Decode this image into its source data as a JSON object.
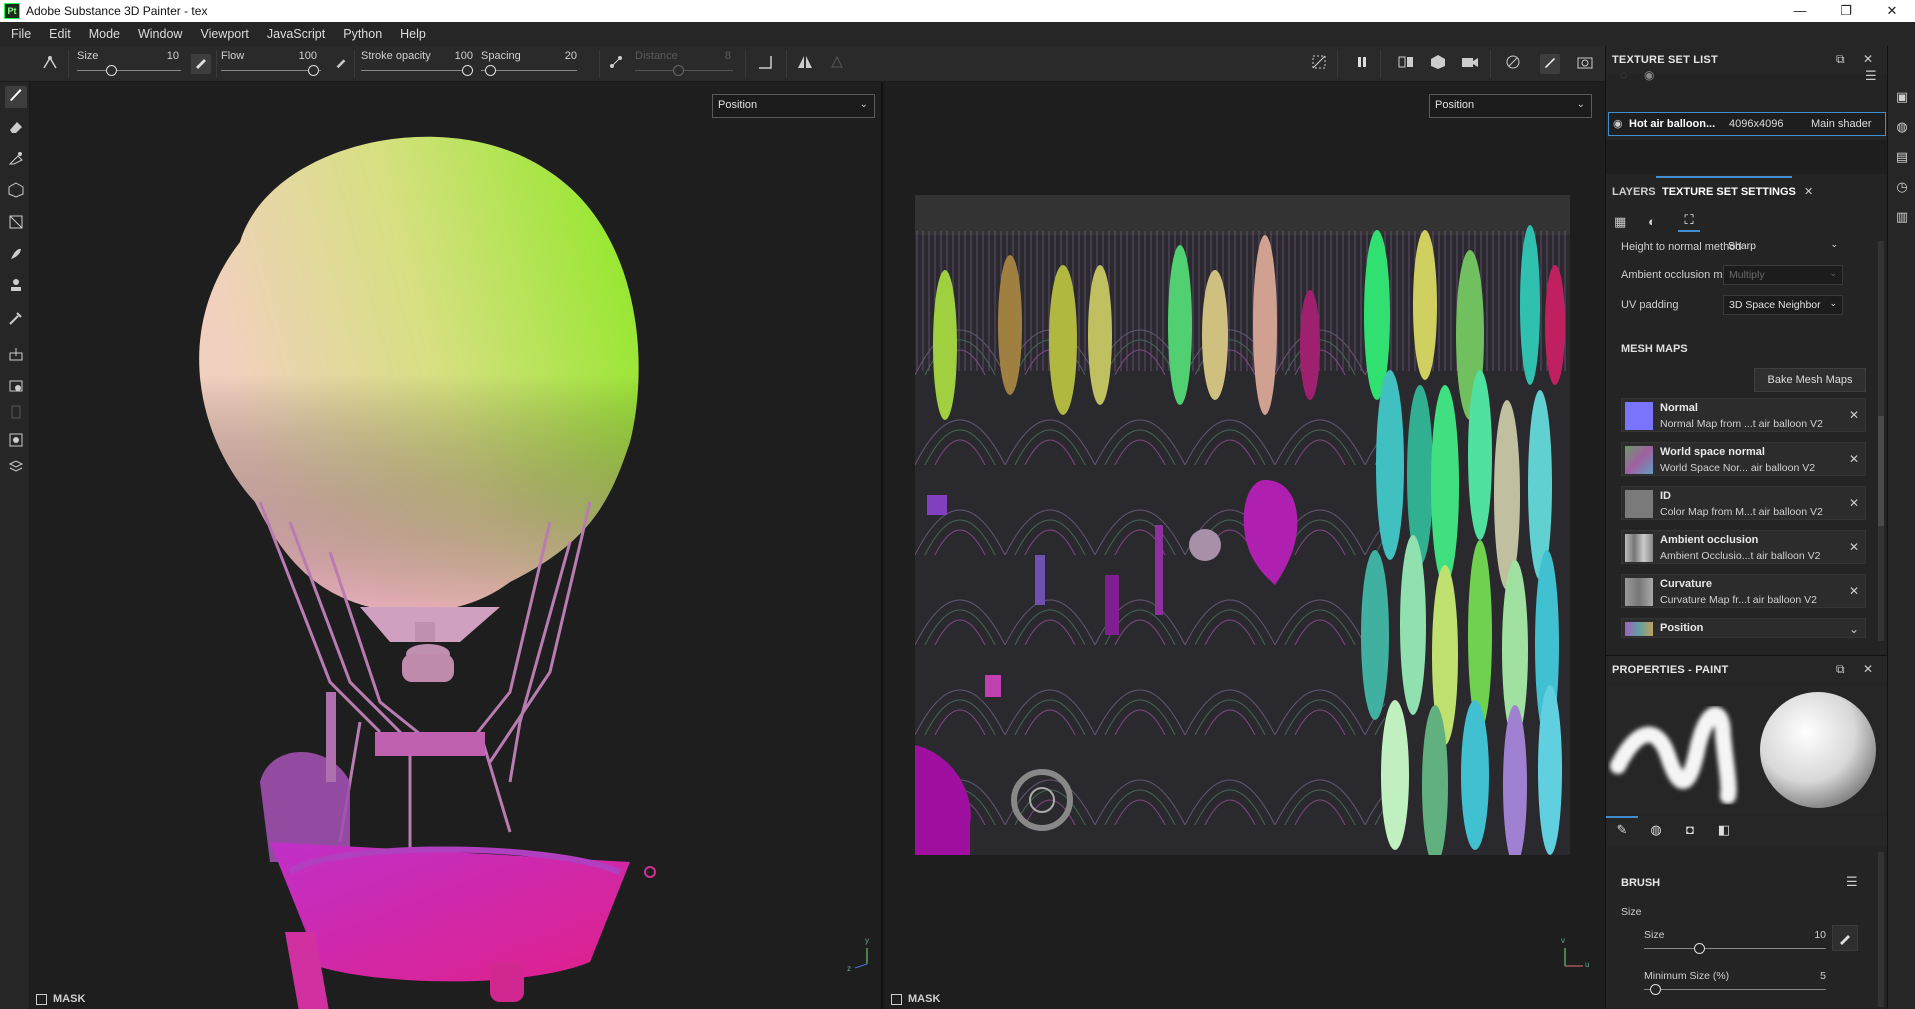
{
  "window": {
    "title": "Adobe Substance 3D Painter - tex",
    "app_icon_text": "Pt",
    "minimize": "—",
    "maximize": "❐",
    "close": "✕"
  },
  "menu": [
    "File",
    "Edit",
    "Mode",
    "Window",
    "Viewport",
    "JavaScript",
    "Python",
    "Help"
  ],
  "toolbar": {
    "size_label": "Size",
    "size_value": "10",
    "flow_label": "Flow",
    "flow_value": "100",
    "stroke_opacity_label": "Stroke opacity",
    "stroke_opacity_value": "100",
    "spacing_label": "Spacing",
    "spacing_value": "20",
    "distance_label": "Distance",
    "distance_value": "8"
  },
  "viewport_3d": {
    "mode": "Position",
    "mask_label": "MASK",
    "axis_y": "y",
    "axis_z": "z"
  },
  "viewport_2d": {
    "mode": "Position",
    "mask_label": "MASK",
    "axis_v": "v",
    "axis_u": "u"
  },
  "texture_set_list": {
    "title": "TEXTURE SET LIST",
    "set_name": "Hot air balloon...",
    "resolution": "4096x4096",
    "shader": "Main shader"
  },
  "tabs": {
    "layers": "LAYERS",
    "texture_set_settings": "TEXTURE SET SETTINGS",
    "close": "✕"
  },
  "settings": {
    "height_to_normal_label": "Height to normal method",
    "height_to_normal_value": "Sharp",
    "ao_mixing_label": "Ambient occlusion mixing",
    "ao_mixing_value": "Multiply",
    "uv_padding_label": "UV padding",
    "uv_padding_value": "3D Space Neighbor"
  },
  "mesh_maps": {
    "title": "MESH MAPS",
    "bake_button": "Bake Mesh Maps",
    "items": [
      {
        "name": "Normal",
        "sub": "Normal Map from ...t air balloon V2",
        "color": "#7b74ff"
      },
      {
        "name": "World space normal",
        "sub": "World Space Nor... air balloon V2",
        "color": "#6a8a6a"
      },
      {
        "name": "ID",
        "sub": "Color Map from M...t air balloon V2",
        "color": "#7a7a7a"
      },
      {
        "name": "Ambient occlusion",
        "sub": "Ambient Occlusio...t air balloon V2",
        "color": "#9a9a9a"
      },
      {
        "name": "Curvature",
        "sub": "Curvature Map fr...t air balloon V2",
        "color": "#8a8a8a"
      },
      {
        "name": "Position",
        "sub": "",
        "color": "#8a7a9a"
      }
    ]
  },
  "properties": {
    "title": "PROPERTIES - PAINT",
    "brush_title": "BRUSH",
    "size_group": "Size",
    "size_label": "Size",
    "size_value": "10",
    "min_size_label": "Minimum Size (%)",
    "min_size_value": "5"
  },
  "colors": {
    "accent": "#3e8ed0",
    "bg_panel": "#242424",
    "bg_viewport": "#1e1e1e"
  }
}
